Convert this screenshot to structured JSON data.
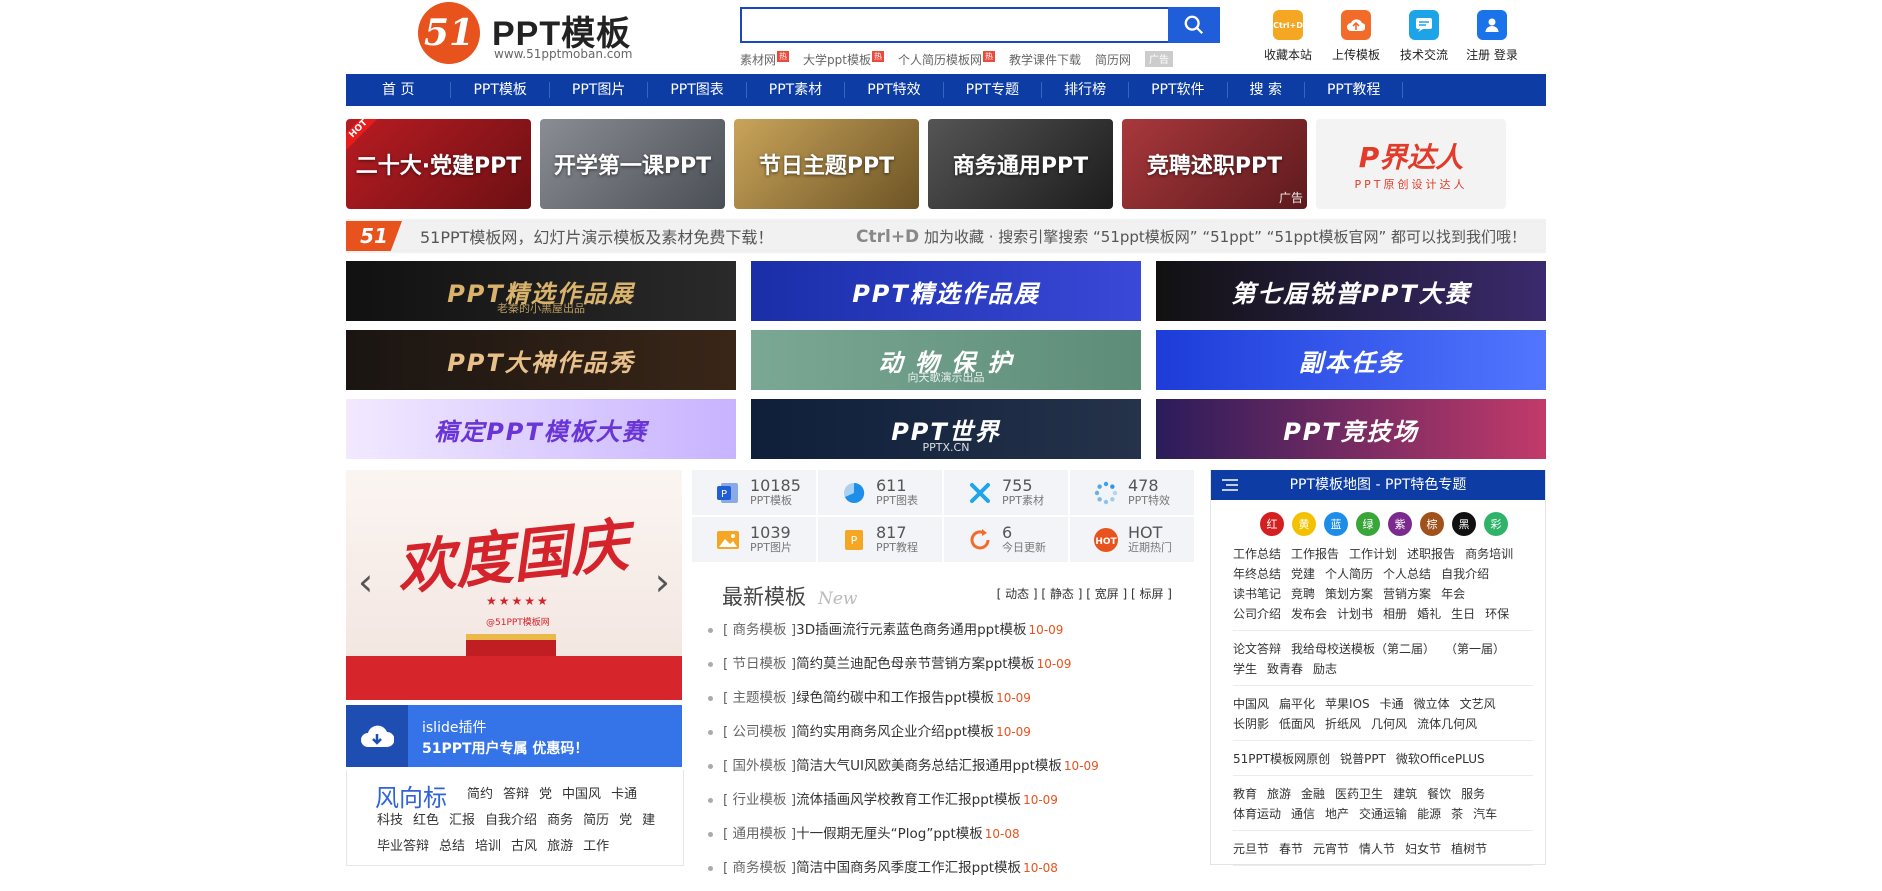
{
  "header": {
    "logo_mark": "51",
    "logo_title": "PPT模板",
    "logo_url": "www.51pptmoban.com",
    "search_placeholder": "",
    "hot_links": [
      {
        "label": "素材网",
        "tag": "热"
      },
      {
        "label": "大学ppt模板",
        "tag": "热"
      },
      {
        "label": "个人简历模板网",
        "tag": "热"
      },
      {
        "label": "教学课件下载",
        "tag": ""
      },
      {
        "label": "简历网",
        "tag": ""
      }
    ],
    "ad_label": "广告",
    "tools": [
      {
        "label": "收藏本站",
        "icon": "ctrl-d-icon",
        "icon_text": "Ctrl+D",
        "color": "#f5a623"
      },
      {
        "label": "上传模板",
        "icon": "upload-icon",
        "icon_text": "",
        "color": "#f36b2b"
      },
      {
        "label": "技术交流",
        "icon": "chat-icon",
        "icon_text": "",
        "color": "#1ca3e8"
      },
      {
        "label": "注册 登录",
        "icon": "user-icon",
        "icon_text": "",
        "color": "#1a73e8"
      }
    ]
  },
  "nav": [
    "首 页",
    "PPT模板",
    "PPT图片",
    "PPT图表",
    "PPT素材",
    "PPT特效",
    "PPT专题",
    "排行榜",
    "PPT软件",
    "搜 索",
    "PPT教程"
  ],
  "tiles": [
    {
      "label": "二十大·党建PPT",
      "bg": "linear-gradient(135deg,#b81c22,#6c1014)",
      "hot": "HOT",
      "ad": ""
    },
    {
      "label": "开学第一课PPT",
      "bg": "linear-gradient(135deg,#8a8e94,#4a4e55)",
      "hot": "",
      "ad": ""
    },
    {
      "label": "节日主题PPT",
      "bg": "linear-gradient(135deg,#c9a45a,#6d5425)",
      "hot": "",
      "ad": ""
    },
    {
      "label": "商务通用PPT",
      "bg": "linear-gradient(135deg,#555,#1c1c1c)",
      "hot": "",
      "ad": ""
    },
    {
      "label": "竞聘述职PPT",
      "bg": "linear-gradient(135deg,#a8383c,#5e1a1d)",
      "hot": "",
      "ad": "广告"
    }
  ],
  "brand_tile": {
    "title": "P界达人",
    "sub": "PPT原创设计达人"
  },
  "notice": {
    "left": "51PPT模板网，幻灯片演示模板及素材免费下载！",
    "hotkey": "Ctrl+D",
    "right": "加为收藏 · 搜索引擎搜索 “51ppt模板网” “51ppt” “51ppt模板官网” 都可以找到我们哦！"
  },
  "banners": [
    {
      "title": "PPT精选作品展",
      "sub": "老秦的小黑屋出品",
      "bg": "linear-gradient(90deg,#111,#2a2a2a)",
      "color": "#d9b36c"
    },
    {
      "title": "PPT精选作品展",
      "sub": "",
      "bg": "linear-gradient(90deg,#1a2ea8,#3a49d8)",
      "color": "#fff"
    },
    {
      "title": "第七届锐普PPT大赛",
      "sub": "",
      "bg": "linear-gradient(90deg,#111,#3b2a6e)",
      "color": "#fff"
    },
    {
      "title": "PPT大神作品秀",
      "sub": "",
      "bg": "linear-gradient(90deg,#1a1512,#3a2618)",
      "color": "#e8c089"
    },
    {
      "title": "动 物 保 护",
      "sub": "向天歌演示出品",
      "bg": "linear-gradient(90deg,#7aa895,#5d8c78)",
      "color": "#fff"
    },
    {
      "title": "副本任务",
      "sub": "",
      "bg": "linear-gradient(90deg,#1d3cd8,#5276ff)",
      "color": "#fff"
    },
    {
      "title": "稿定PPT模板大赛",
      "sub": "",
      "bg": "linear-gradient(90deg,#f2e9ff,#c7b3ff)",
      "color": "#6a35d6"
    },
    {
      "title": "PPT世界",
      "sub": "PPTX.CN",
      "bg": "linear-gradient(90deg,#0f1f3a,#25324a)",
      "color": "#fff"
    },
    {
      "title": "PPT竞技场",
      "sub": "",
      "bg": "linear-gradient(90deg,#2a1c5a,#c23a6a)",
      "color": "#fff"
    }
  ],
  "slider": {
    "title": "欢度国庆",
    "stars": "★★★★★",
    "sub": "@51PPT模板网"
  },
  "islide": {
    "line1": "islide插件",
    "line2": "51PPT用户专属 优惠码！"
  },
  "wind": {
    "title": "风向标",
    "tags": [
      "简约",
      "答辩",
      "党",
      "中国风",
      "卡通",
      "科技",
      "红色",
      "汇报",
      "自我介绍",
      "商务",
      "简历",
      "党",
      "建",
      "毕业答辩",
      "总结",
      "培训",
      "古风",
      "旅游",
      "工作"
    ]
  },
  "stats": [
    {
      "value": "10185",
      "label": "PPT模板",
      "icon": "ppt-icon",
      "color": "#1f5ed8"
    },
    {
      "value": "611",
      "label": "PPT图表",
      "icon": "pie-chart-icon",
      "color": "#1f8ee8"
    },
    {
      "value": "755",
      "label": "PPT素材",
      "icon": "tools-icon",
      "color": "#1fa5e8"
    },
    {
      "value": "478",
      "label": "PPT特效",
      "icon": "loading-icon",
      "color": "#1f8ee8"
    },
    {
      "value": "1039",
      "label": "PPT图片",
      "icon": "image-icon",
      "color": "#f5a623"
    },
    {
      "value": "817",
      "label": "PPT教程",
      "icon": "book-icon",
      "color": "#f5a623"
    },
    {
      "value": "6",
      "label": "今日更新",
      "icon": "refresh-icon",
      "color": "#f36b2b"
    },
    {
      "value": "HOT",
      "label": "近期热门",
      "icon": "hot-icon",
      "color": "#e8521d"
    }
  ],
  "latest": {
    "title": "最新模板",
    "title_en": "New",
    "filters": "[ 动态 ] [ 静态 ] [ 宽屏 ] [ 标屏 ]",
    "items": [
      {
        "cat": "[ 商务模板 ]",
        "title": "3D插画流行元素蓝色商务通用ppt模板",
        "date": "10-09"
      },
      {
        "cat": "[ 节日模板 ]",
        "title": "简约莫兰迪配色母亲节营销方案ppt模板",
        "date": "10-09"
      },
      {
        "cat": "[ 主题模板 ]",
        "title": "绿色简约碳中和工作报告ppt模板",
        "date": "10-09"
      },
      {
        "cat": "[ 公司模板 ]",
        "title": "简约实用商务风企业介绍ppt模板",
        "date": "10-09"
      },
      {
        "cat": "[ 国外模板 ]",
        "title": "简洁大气UI风欧美商务总结汇报通用ppt模板",
        "date": "10-09"
      },
      {
        "cat": "[ 行业模板 ]",
        "title": "流体插画风学校教育工作汇报ppt模板",
        "date": "10-09"
      },
      {
        "cat": "[ 通用模板 ]",
        "title": "十一假期无厘头“Plog”ppt模板",
        "date": "10-08"
      },
      {
        "cat": "[ 商务模板 ]",
        "title": "简洁中国商务风季度工作汇报ppt模板",
        "date": "10-08"
      }
    ]
  },
  "side": {
    "title": "PPT模板地图 - PPT特色专题",
    "colors": [
      {
        "label": "红",
        "color": "#d42020"
      },
      {
        "label": "黄",
        "color": "#f2c200"
      },
      {
        "label": "蓝",
        "color": "#1d8de8"
      },
      {
        "label": "绿",
        "color": "#3aa63a"
      },
      {
        "label": "紫",
        "color": "#7b2a8e"
      },
      {
        "label": "棕",
        "color": "#a0521d"
      },
      {
        "label": "黑",
        "color": "#111111"
      },
      {
        "label": "彩",
        "color": "#2fb36a"
      }
    ],
    "blocks": [
      [
        "工作总结",
        "工作报告",
        "工作计划",
        "述职报告",
        "商务培训",
        "年终总结",
        "党建",
        "个人简历",
        "个人总结",
        "自我介绍",
        "读书笔记",
        "竞聘",
        "策划方案",
        "营销方案",
        "年会",
        "公司介绍",
        "发布会",
        "计划书",
        "相册",
        "婚礼",
        "生日",
        "环保"
      ],
      [
        "论文答辩",
        "我给母校送模板（第二届）",
        "（第一届）",
        "学生",
        "致青春",
        "励志"
      ],
      [
        "中国风",
        "扁平化",
        "苹果IOS",
        "卡通",
        "微立体",
        "文艺风",
        "长阴影",
        "低面风",
        "折纸风",
        "几何风",
        "流体几何风"
      ],
      [
        "51PPT模板网原创",
        "锐普PPT",
        "微软OfficePLUS"
      ],
      [
        "教育",
        "旅游",
        "金融",
        "医药卫生",
        "建筑",
        "餐饮",
        "服务",
        "体育运动",
        "通信",
        "地产",
        "交通运输",
        "能源",
        "茶",
        "汽车"
      ],
      [
        "元旦节",
        "春节",
        "元宵节",
        "情人节",
        "妇女节",
        "植树节"
      ]
    ]
  }
}
